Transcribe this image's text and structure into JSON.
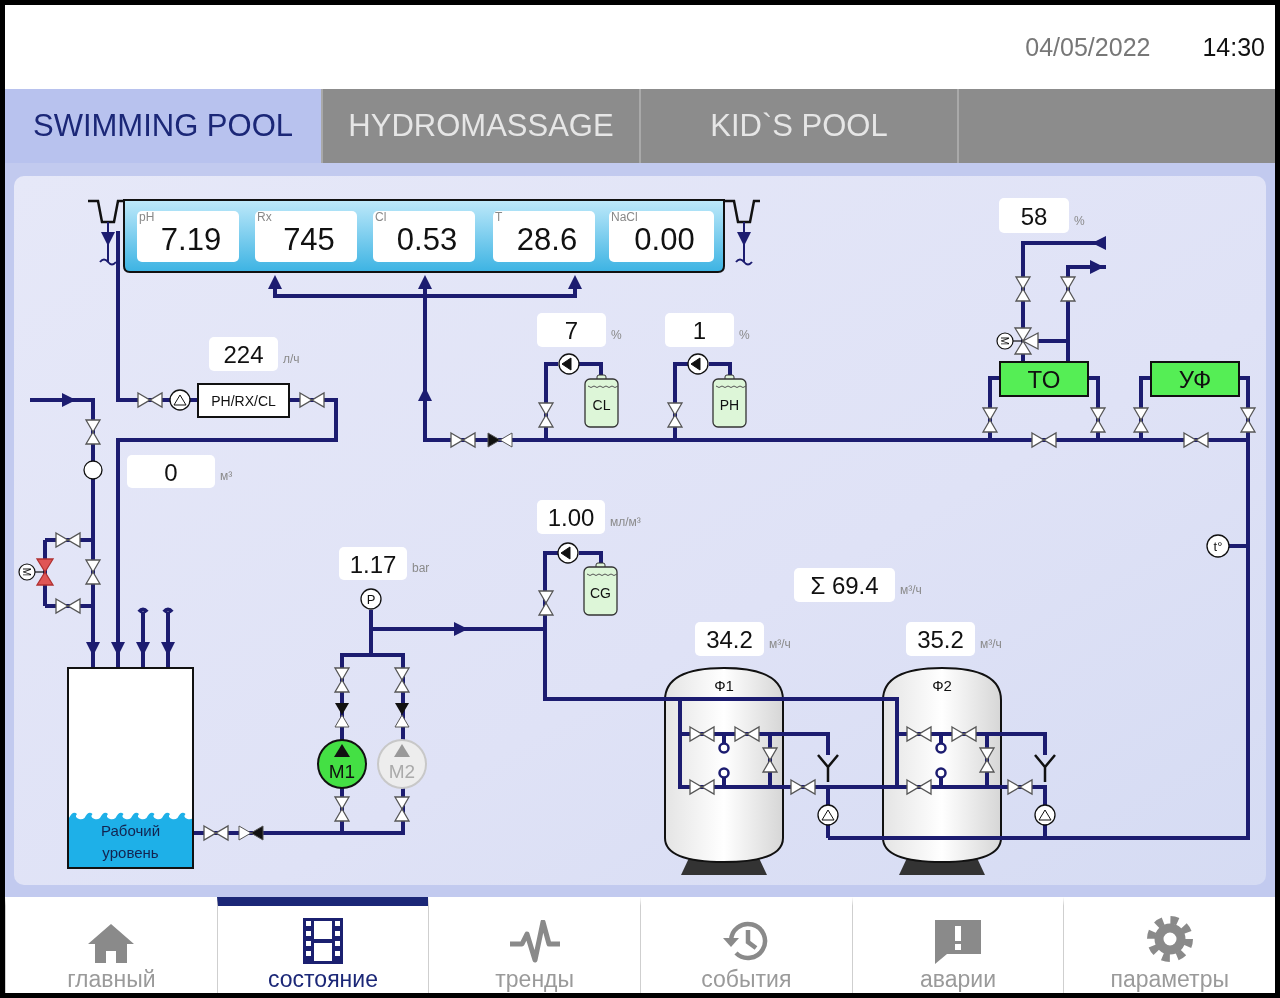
{
  "header": {
    "date": "04/05/2022",
    "time": "14:30"
  },
  "tabs": [
    {
      "label": "SWIMMING POOL",
      "selected": true
    },
    {
      "label": "HYDROMASSAGE",
      "selected": false
    },
    {
      "label": "KID`S POOL",
      "selected": false
    }
  ],
  "pool_sensors": [
    {
      "label": "pH",
      "value": "7.19"
    },
    {
      "label": "Rx",
      "value": "745"
    },
    {
      "label": "Cl",
      "value": "0.53"
    },
    {
      "label": "T",
      "value": "28.6"
    },
    {
      "label": "NaCl",
      "value": "0.00"
    }
  ],
  "readings": [
    {
      "value": "224",
      "unit": "л/ч"
    },
    {
      "value": "0",
      "unit": "м³"
    },
    {
      "value": "7",
      "unit": "%"
    },
    {
      "value": "1",
      "unit": "%"
    },
    {
      "value": "58",
      "unit": "%"
    },
    {
      "value": "1.00",
      "unit": "мл/м³"
    },
    {
      "value": "1.17",
      "unit": "bar"
    },
    {
      "value": "Σ 69.4",
      "unit": "м³/ч"
    },
    {
      "value": "34.2",
      "unit": "м³/ч"
    },
    {
      "value": "35.2",
      "unit": "м³/ч"
    }
  ],
  "analyzer": {
    "label": "PH/RX/CL"
  },
  "dosing_tanks": [
    {
      "label": "CL"
    },
    {
      "label": "PH"
    },
    {
      "label": "CG"
    }
  ],
  "units": [
    {
      "label": "TO",
      "on": true
    },
    {
      "label": "УФ",
      "on": true
    }
  ],
  "valve_actuators": [
    {
      "label": "M",
      "alarm": true
    },
    {
      "label": "M",
      "alarm": false
    }
  ],
  "pumps": [
    {
      "label": "M1",
      "running": true
    },
    {
      "label": "M2",
      "running": false
    }
  ],
  "filters": [
    {
      "label": "Ф1"
    },
    {
      "label": "Ф2"
    }
  ],
  "buffer_tank": {
    "label": "Рабочий уровень",
    "level": 0.28
  },
  "gauges": {
    "pressure": "P",
    "temperature": "t°"
  },
  "nav": [
    {
      "label": "главный",
      "selected": false
    },
    {
      "label": "состояние",
      "selected": true
    },
    {
      "label": "тренды",
      "selected": false
    },
    {
      "label": "события",
      "selected": false
    },
    {
      "label": "аварии",
      "selected": false
    },
    {
      "label": "параметры",
      "selected": false
    }
  ]
}
